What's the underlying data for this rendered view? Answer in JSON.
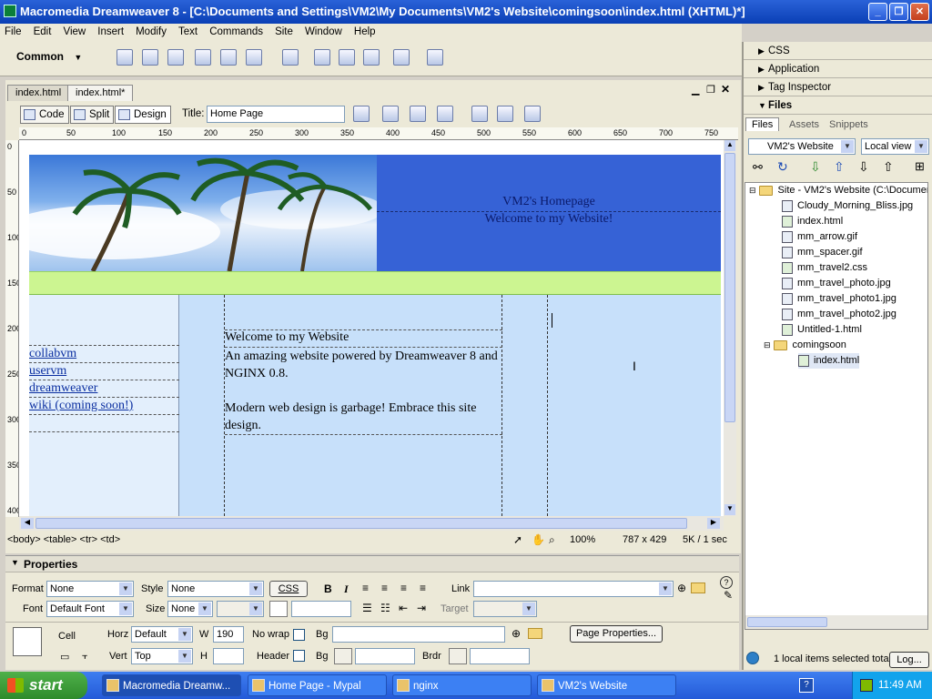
{
  "window": {
    "title": "Macromedia Dreamweaver 8 - [C:\\Documents and Settings\\VM2\\My Documents\\VM2's Website\\comingsoon\\index.html (XHTML)*]"
  },
  "menu": [
    "File",
    "Edit",
    "View",
    "Insert",
    "Modify",
    "Text",
    "Commands",
    "Site",
    "Window",
    "Help"
  ],
  "insertbar": {
    "category": "Common"
  },
  "doc_tabs": [
    "index.html",
    "index.html*"
  ],
  "doc_toolbar": {
    "code": "Code",
    "split": "Split",
    "design": "Design",
    "title_label": "Title:",
    "title_value": "Home Page"
  },
  "ruler": {
    "top": [
      "0",
      "50",
      "100",
      "150",
      "200",
      "250",
      "300",
      "350",
      "400",
      "450",
      "500",
      "550",
      "600",
      "650",
      "700",
      "750"
    ],
    "left": [
      "0",
      "50",
      "100",
      "150",
      "200",
      "250",
      "300",
      "350",
      "400"
    ]
  },
  "page": {
    "header_line1": "VM2's Homepage",
    "header_line2": "Welcome to my Website!",
    "nav_links": [
      "collabvm",
      "uservm",
      "dreamweaver",
      "wiki (coming soon!)"
    ],
    "content_title": "Welcome to my Website",
    "content_line1": "An amazing website powered by Dreamweaver 8 and NGINX 0.8.",
    "content_line2": "Modern web design is garbage! Embrace this site design.",
    "colors": {
      "header_blue": "#3662d6",
      "green_bar": "#ccf591",
      "body_blue": "#c7e0fa",
      "left_col": "#e3effc"
    }
  },
  "status": {
    "tag_selector": "<body> <table> <tr> <td>",
    "zoom": "100%",
    "size": "787 x 429",
    "download": "5K / 1 sec"
  },
  "properties": {
    "panel_title": "Properties",
    "format_label": "Format",
    "format_value": "None",
    "style_label": "Style",
    "style_value": "None",
    "css_button": "CSS",
    "link_label": "Link",
    "font_label": "Font",
    "font_value": "Default Font",
    "size_label": "Size",
    "size_value": "None",
    "target_label": "Target",
    "cell_label": "Cell",
    "horz_label": "Horz",
    "horz_value": "Default",
    "w_label": "W",
    "w_value": "190",
    "nowrap_label": "No wrap",
    "bg_label": "Bg",
    "page_props_button": "Page Properties...",
    "vert_label": "Vert",
    "vert_value": "Top",
    "h_label": "H",
    "header_label": "Header",
    "bg2_label": "Bg",
    "brdr_label": "Brdr",
    "bold": "B",
    "italic": "I"
  },
  "rightpanel": {
    "css": "CSS",
    "application": "Application",
    "tag_inspector": "Tag Inspector",
    "files": "Files",
    "tabs": [
      "Files",
      "Assets",
      "Snippets"
    ],
    "site_select": "VM2's Website",
    "view_select": "Local view",
    "tree": [
      {
        "label": "Site - VM2's Website (C:\\Documer",
        "type": "site"
      },
      {
        "label": "Cloudy_Morning_Bliss.jpg",
        "type": "img"
      },
      {
        "label": "index.html",
        "type": "html"
      },
      {
        "label": "mm_arrow.gif",
        "type": "img"
      },
      {
        "label": "mm_spacer.gif",
        "type": "img"
      },
      {
        "label": "mm_travel2.css",
        "type": "css"
      },
      {
        "label": "mm_travel_photo.jpg",
        "type": "img"
      },
      {
        "label": "mm_travel_photo1.jpg",
        "type": "img"
      },
      {
        "label": "mm_travel_photo2.jpg",
        "type": "img"
      },
      {
        "label": "Untitled-1.html",
        "type": "html"
      },
      {
        "label": "comingsoon",
        "type": "folder"
      },
      {
        "label": "index.html",
        "type": "html"
      }
    ],
    "status": "1 local items selected tota",
    "log_button": "Log..."
  },
  "taskbar": {
    "start": "start",
    "tasks": [
      "Macromedia Dreamw...",
      "Home Page - Mypal",
      "nginx",
      "VM2's Website"
    ],
    "clock": "11:49 AM"
  }
}
